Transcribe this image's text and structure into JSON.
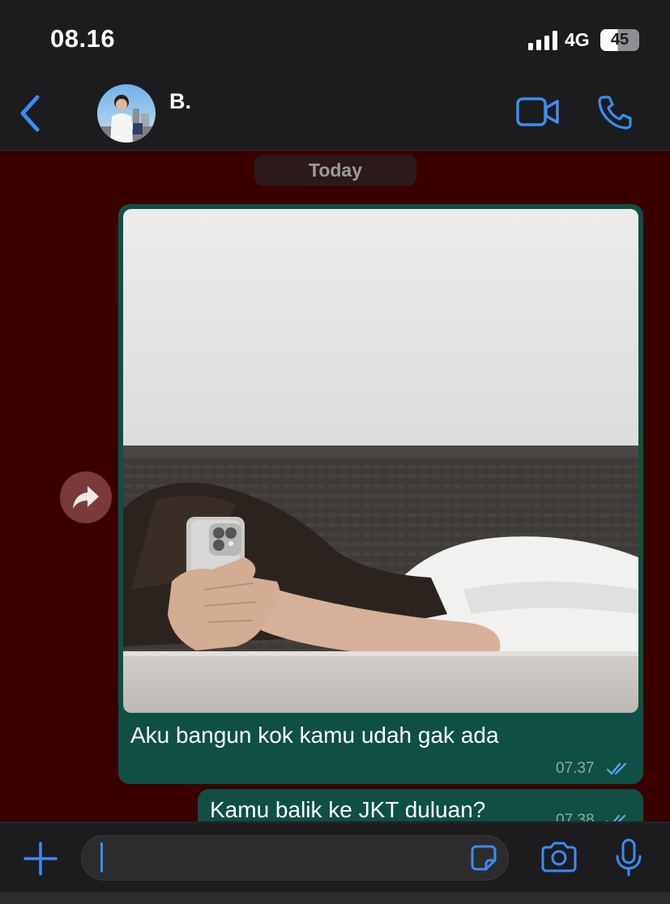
{
  "status_bar": {
    "time": "08.16",
    "network": "4G",
    "battery": "45",
    "battery_level": 0.45
  },
  "header": {
    "contact_name": "B.",
    "icons": {
      "back": "chevron-left-icon",
      "video_call": "video-camera-icon",
      "voice_call": "phone-icon"
    }
  },
  "chat": {
    "date_label": "Today",
    "messages": [
      {
        "type": "image",
        "direction": "outgoing",
        "text": "Aku bangun kok kamu udah gak ada",
        "time": "07.37",
        "status": "read"
      },
      {
        "type": "text",
        "direction": "outgoing",
        "text": "Kamu balik ke JKT duluan?",
        "time": "07.38",
        "status": "read"
      }
    ]
  },
  "composer": {
    "input_value": "",
    "icons": {
      "attach": "plus-icon",
      "sticker": "sticker-icon",
      "camera": "camera-icon",
      "mic": "microphone-icon"
    }
  },
  "colors": {
    "accent": "#3b8df5",
    "outgoing_bubble": "#0f4f45",
    "chat_background": "#3a0000",
    "read_tick": "#5ba7f7"
  }
}
